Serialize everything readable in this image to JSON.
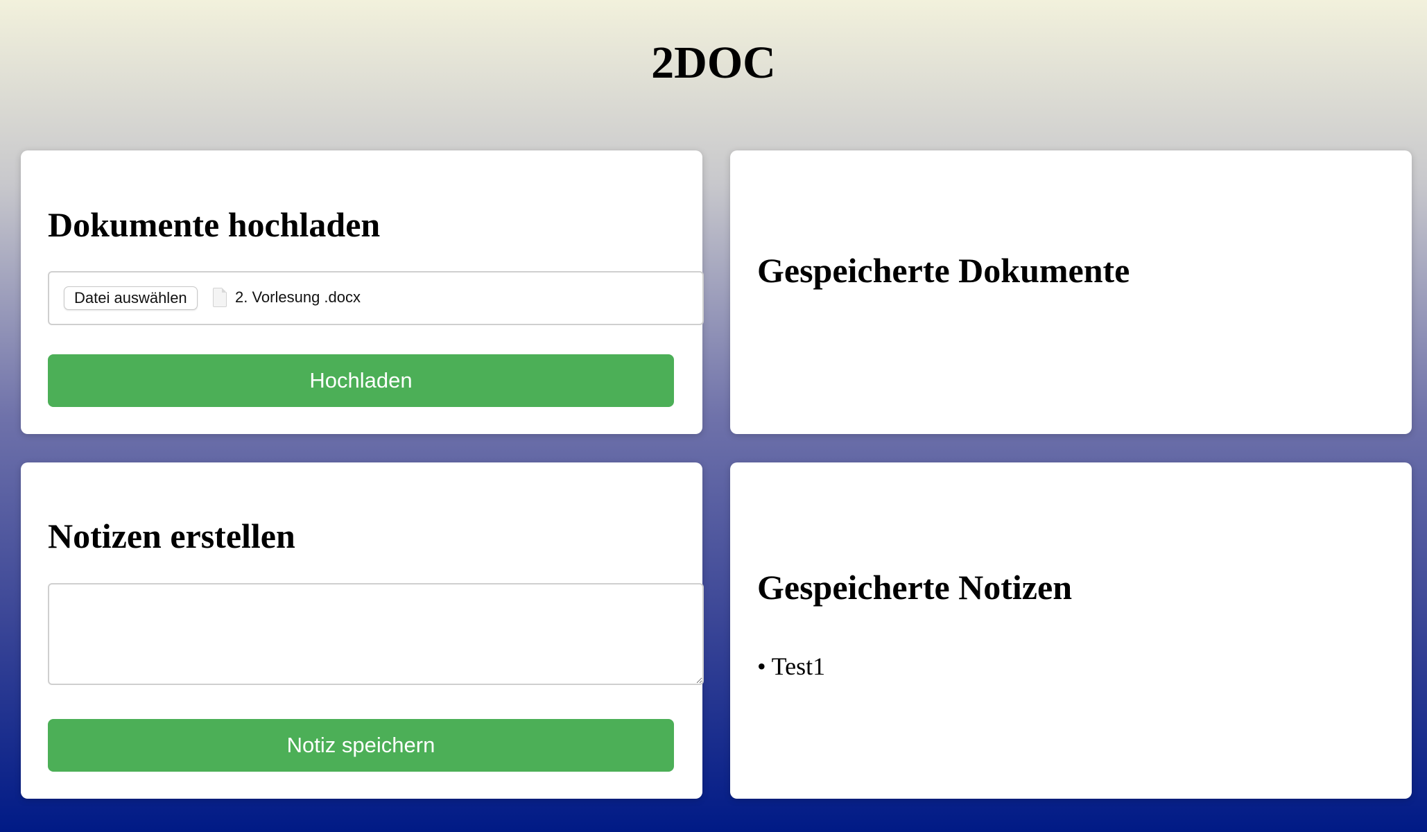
{
  "app": {
    "title": "2DOC"
  },
  "upload": {
    "heading": "Dokumente hochladen",
    "file_button_label": "Datei auswählen",
    "file_icon": "document-file-icon",
    "selected_file": "2. Vorlesung .docx",
    "submit_label": "Hochladen"
  },
  "documents": {
    "heading": "Gespeicherte Dokumente",
    "items": []
  },
  "notes_form": {
    "heading": "Notizen erstellen",
    "textarea_value": "",
    "submit_label": "Notiz speichern"
  },
  "notes": {
    "heading": "Gespeicherte Notizen",
    "items": [
      {
        "bullet": "•",
        "text": "Test1"
      }
    ]
  },
  "colors": {
    "primary_button": "#4caf57",
    "button_text": "#ffffff",
    "background_top": "#f2f1dc",
    "background_bottom": "#001a86",
    "card_background": "#ffffff"
  }
}
